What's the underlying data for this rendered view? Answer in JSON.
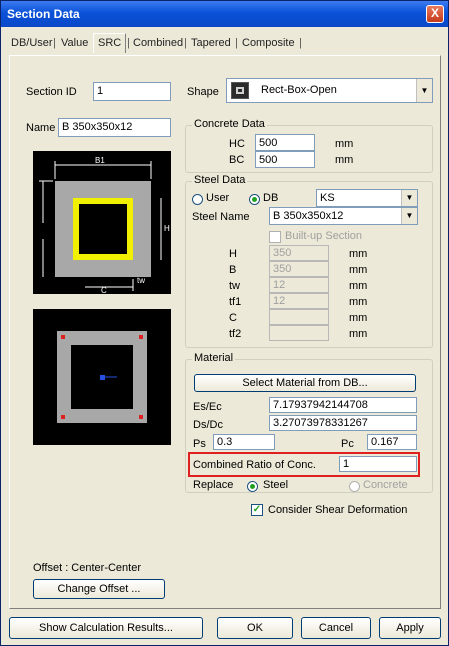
{
  "window": {
    "title": "Section Data",
    "close_symbol": "X"
  },
  "tabs": [
    {
      "label": "DB/User",
      "active": false
    },
    {
      "label": "Value",
      "active": false
    },
    {
      "label": "SRC",
      "active": true
    },
    {
      "label": "Combined",
      "active": false
    },
    {
      "label": "Tapered",
      "active": false
    },
    {
      "label": "Composite",
      "active": false
    }
  ],
  "section": {
    "id_label": "Section ID",
    "id_value": "1",
    "name_label": "Name",
    "name_value": "B 350x350x12"
  },
  "shape": {
    "label": "Shape",
    "value": "Rect-Box-Open",
    "icon": "rect-box-icon"
  },
  "concrete": {
    "title": "Concrete Data",
    "hc_label": "HC",
    "hc_value": "500",
    "hc_unit": "mm",
    "bc_label": "BC",
    "bc_value": "500",
    "bc_unit": "mm"
  },
  "steel": {
    "title": "Steel Data",
    "user_label": "User",
    "db_label": "DB",
    "source": "DB",
    "db_value": "KS",
    "name_label": "Steel Name",
    "name_value": "B 350x350x12",
    "built_up_label": "Built-up Section",
    "dims": [
      {
        "label": "H",
        "value": "350",
        "unit": "mm"
      },
      {
        "label": "B",
        "value": "350",
        "unit": "mm"
      },
      {
        "label": "tw",
        "value": "12",
        "unit": "mm"
      },
      {
        "label": "tf1",
        "value": "12",
        "unit": "mm"
      },
      {
        "label": "C",
        "value": "",
        "unit": "mm"
      },
      {
        "label": "tf2",
        "value": "",
        "unit": "mm"
      }
    ]
  },
  "material": {
    "title": "Material",
    "select_button": "Select Material from DB...",
    "es_ec_label": "Es/Ec",
    "es_ec_value": "7.17937942144708",
    "ds_dc_label": "Ds/Dc",
    "ds_dc_value": "3.27073978331267",
    "ps_label": "Ps",
    "ps_value": "0.3",
    "pc_label": "Pc",
    "pc_value": "0.167",
    "ratio_label": "Combined Ratio of Conc.",
    "ratio_value": "1",
    "replace_label": "Replace",
    "replace_steel": "Steel",
    "replace_concrete": "Concrete",
    "replace_selected": "Steel"
  },
  "shear": {
    "label": "Consider Shear Deformation",
    "checked": true
  },
  "offset": {
    "label": "Offset : Center-Center",
    "button": "Change Offset ..."
  },
  "footer": {
    "show_calc": "Show Calculation Results...",
    "ok": "OK",
    "cancel": "Cancel",
    "apply": "Apply"
  },
  "diagram": {
    "b1_label": "B1",
    "h_label": "H",
    "tw_label": "tw",
    "c_label": "C"
  },
  "colors": {
    "title_bar": "#0a52d8",
    "concrete": "#a8a8a8",
    "steel": "#f0f000",
    "highlight": "#e02020"
  }
}
